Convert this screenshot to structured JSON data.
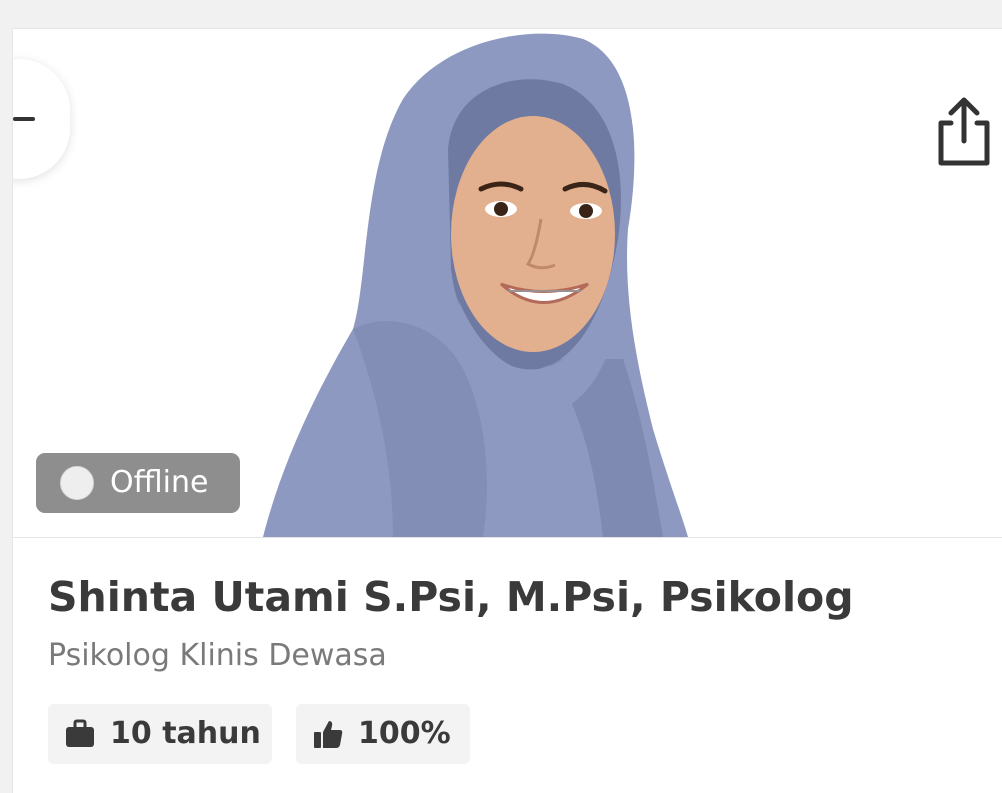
{
  "profile": {
    "status": "Offline",
    "name": "Shinta Utami S.Psi, M.Psi, Psikolog",
    "specialty": "Psikolog Klinis Dewasa",
    "experience": "10 tahun",
    "rating": "100%"
  },
  "icons": {
    "back": "minus-icon",
    "share": "share-icon",
    "experience": "briefcase-icon",
    "rating": "thumbs-up-icon",
    "status": "status-dot-icon"
  },
  "colors": {
    "status_pill": "#8e8e8e",
    "hijab": "#8d99c0",
    "text_dark": "#3a3a3a",
    "text_muted": "#7a7a7a"
  }
}
